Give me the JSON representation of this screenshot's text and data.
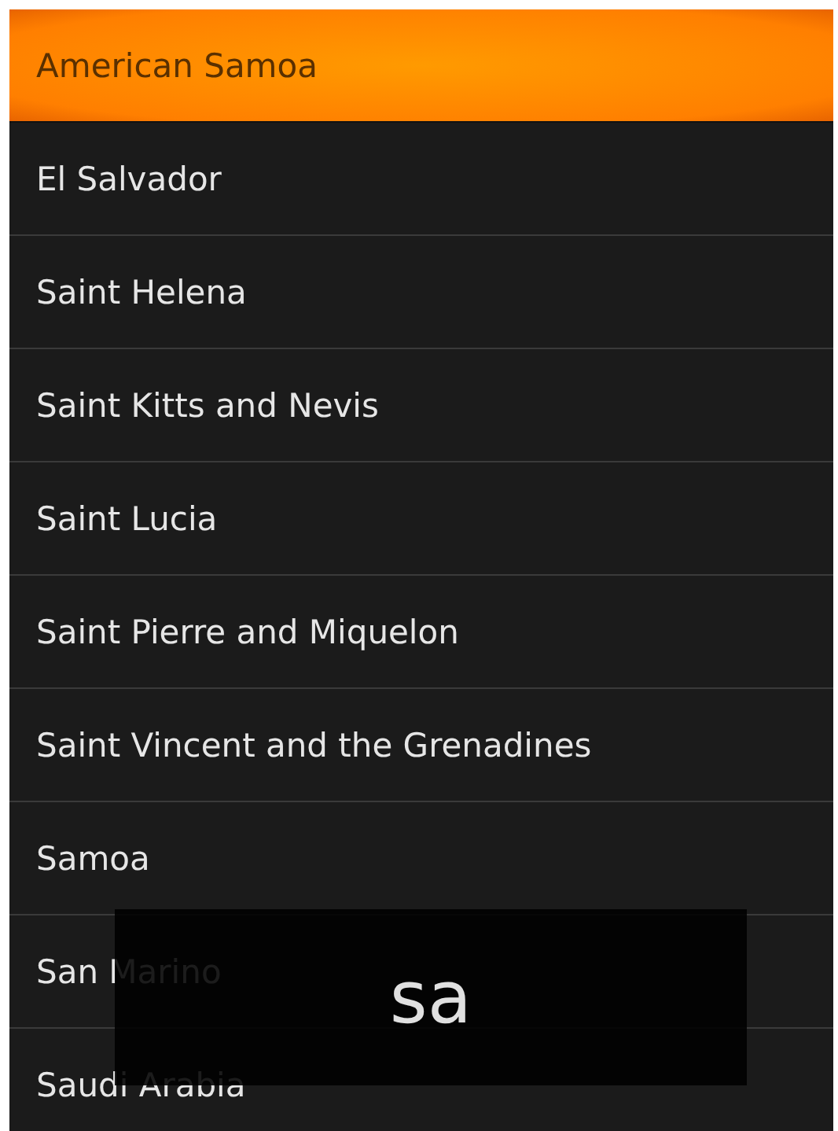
{
  "list": [
    {
      "label": "American Samoa",
      "selected": true
    },
    {
      "label": "El Salvador",
      "selected": false
    },
    {
      "label": "Saint Helena",
      "selected": false
    },
    {
      "label": "Saint Kitts and Nevis",
      "selected": false
    },
    {
      "label": "Saint Lucia",
      "selected": false
    },
    {
      "label": "Saint Pierre and Miquelon",
      "selected": false
    },
    {
      "label": "Saint Vincent and the Grenadines",
      "selected": false
    },
    {
      "label": "Samoa",
      "selected": false
    },
    {
      "label": "San Marino",
      "selected": false
    },
    {
      "label": "Saudi Arabia",
      "selected": false
    }
  ],
  "fast_scroll_overlay": {
    "text": "sa"
  }
}
